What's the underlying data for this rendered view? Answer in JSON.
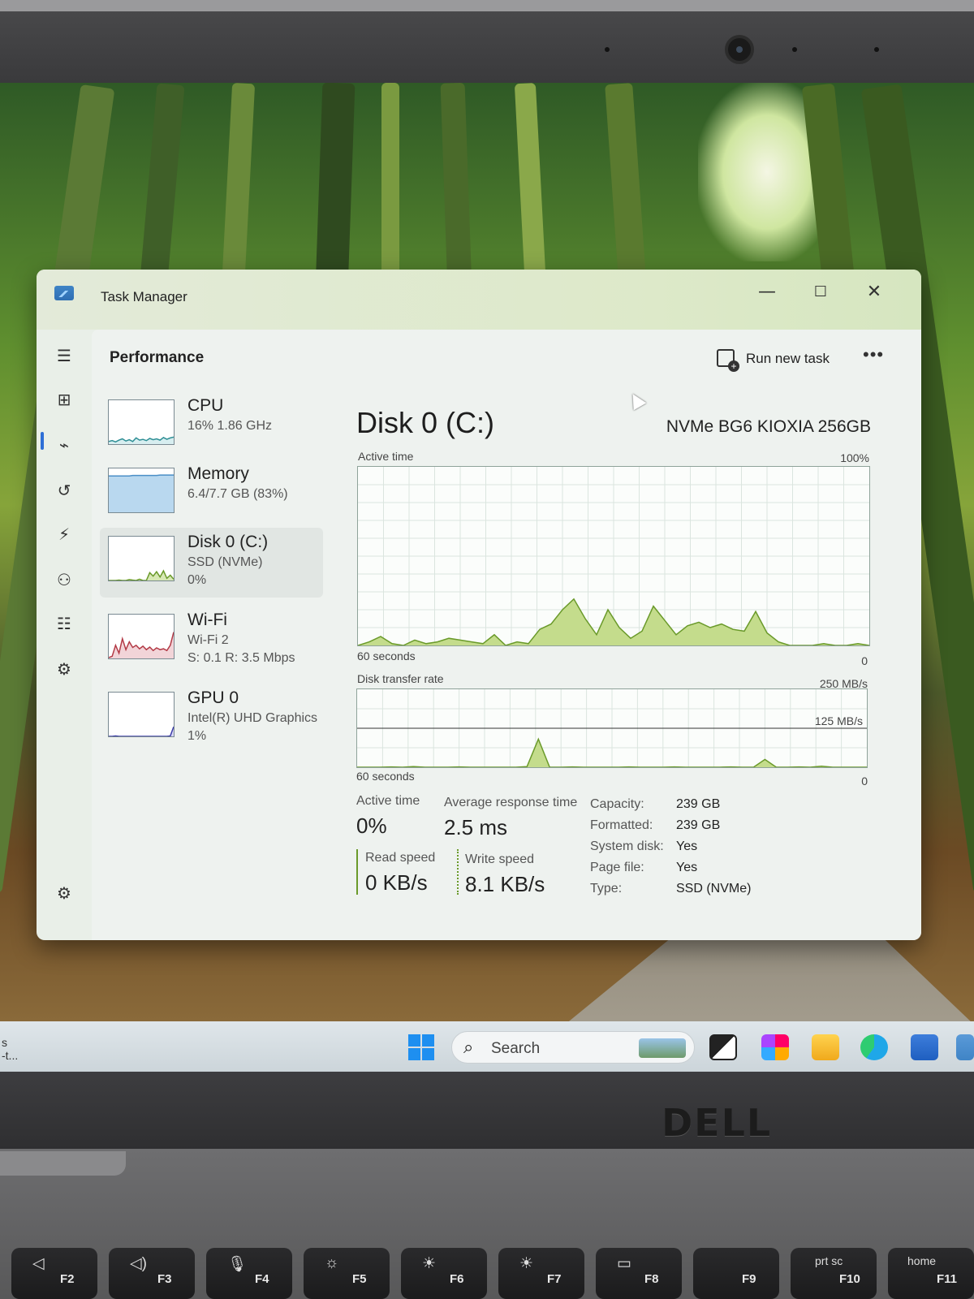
{
  "window": {
    "title": "Task Manager",
    "minimize_glyph": "—",
    "maximize_glyph": "☐",
    "close_glyph": "✕"
  },
  "page": {
    "title": "Performance",
    "run_new_task": "Run new task",
    "more_glyph": "•••"
  },
  "nav": {
    "icons": [
      "hamburger-icon",
      "processes-icon",
      "performance-icon",
      "app-history-icon",
      "startup-apps-icon",
      "users-icon",
      "details-icon",
      "services-icon",
      "settings-icon"
    ],
    "glyphs": [
      "☰",
      "⊞",
      "⌁",
      "↺",
      "⚡",
      "⚇",
      "☷",
      "⚙",
      "⚙"
    ]
  },
  "devices": [
    {
      "name": "CPU",
      "sub1": "16%  1.86 GHz",
      "sub2": "",
      "color": "#2f8f95",
      "selected": false
    },
    {
      "name": "Memory",
      "sub1": "6.4/7.7 GB (83%)",
      "sub2": "",
      "color": "#4b8fc7",
      "selected": false
    },
    {
      "name": "Disk 0 (C:)",
      "sub1": "SSD (NVMe)",
      "sub2": "0%",
      "color": "#6a9a2a",
      "selected": true
    },
    {
      "name": "Wi-Fi",
      "sub1": "Wi-Fi 2",
      "sub2": "S: 0.1  R: 3.5 Mbps",
      "color": "#b33a46",
      "selected": false
    },
    {
      "name": "GPU 0",
      "sub1": "Intel(R) UHD Graphics",
      "sub2": "1%",
      "color": "#3a3aa8",
      "selected": false
    }
  ],
  "detail": {
    "title": "Disk 0 (C:)",
    "model": "NVMe BG6 KIOXIA 256GB",
    "active_time_label": "Active time",
    "active_time_max": "100%",
    "active_time_span": "60 seconds",
    "active_time_min": "0",
    "transfer_label": "Disk transfer rate",
    "transfer_max": "250 MB/s",
    "transfer_mid": "125 MB/s",
    "transfer_span": "60 seconds",
    "transfer_min": "0"
  },
  "stats": {
    "active_time_label": "Active time",
    "active_time_value": "0%",
    "avg_response_label": "Average response time",
    "avg_response_value": "2.5 ms",
    "read_speed_label": "Read speed",
    "read_speed_value": "0 KB/s",
    "write_speed_label": "Write speed",
    "write_speed_value": "8.1 KB/s"
  },
  "properties": [
    {
      "key": "Capacity:",
      "value": "239 GB"
    },
    {
      "key": "Formatted:",
      "value": "239 GB"
    },
    {
      "key": "System disk:",
      "value": "Yes"
    },
    {
      "key": "Page file:",
      "value": "Yes"
    },
    {
      "key": "Type:",
      "value": "SSD (NVMe)"
    }
  ],
  "chart_data": [
    {
      "type": "area",
      "title": "Active time",
      "ylim": [
        0,
        100
      ],
      "x_span_seconds": 60,
      "values": [
        0,
        2,
        5,
        1,
        0,
        3,
        1,
        2,
        4,
        3,
        2,
        1,
        6,
        0,
        2,
        1,
        9,
        12,
        20,
        26,
        15,
        6,
        20,
        10,
        4,
        8,
        22,
        14,
        6,
        11,
        13,
        10,
        12,
        9,
        8,
        19,
        7,
        2,
        0,
        0,
        0,
        1,
        0,
        0,
        1,
        0
      ]
    },
    {
      "type": "area",
      "title": "Disk transfer rate",
      "ylim": [
        0,
        250
      ],
      "x_span_seconds": 60,
      "values": [
        0,
        0,
        0,
        1,
        0,
        2,
        0,
        0,
        0,
        1,
        0,
        0,
        0,
        0,
        0,
        2,
        90,
        0,
        0,
        1,
        0,
        0,
        0,
        0,
        1,
        0,
        0,
        0,
        1,
        0,
        0,
        0,
        0,
        1,
        0,
        0,
        25,
        0,
        0,
        1,
        0,
        3,
        0,
        0,
        0,
        0
      ]
    }
  ],
  "thumbs": {
    "cpu": [
      6,
      8,
      5,
      9,
      12,
      7,
      10,
      6,
      14,
      9,
      11,
      8,
      13,
      10,
      12,
      9,
      15,
      11,
      14,
      16
    ],
    "memory": [
      83,
      83,
      83,
      83,
      83,
      83,
      83,
      84,
      84,
      84,
      84,
      84,
      84,
      84,
      84,
      85,
      85,
      85,
      85,
      85
    ],
    "disk": [
      0,
      0,
      0,
      1,
      0,
      0,
      2,
      1,
      0,
      3,
      0,
      0,
      18,
      10,
      20,
      8,
      22,
      5,
      12,
      3
    ],
    "wifi": [
      2,
      5,
      30,
      12,
      45,
      20,
      38,
      25,
      30,
      22,
      28,
      20,
      26,
      18,
      24,
      20,
      22,
      18,
      30,
      60
    ],
    "gpu": [
      0,
      0,
      1,
      0,
      0,
      0,
      0,
      0,
      0,
      0,
      0,
      0,
      0,
      0,
      0,
      0,
      0,
      0,
      1,
      22
    ]
  },
  "taskbar": {
    "left_text_1": "s",
    "left_text_2": "-t...",
    "search_placeholder": "Search",
    "app_icons": [
      "task-view-icon",
      "copilot-icon",
      "file-explorer-icon",
      "edge-icon",
      "store-icon",
      "task-manager-icon"
    ]
  },
  "laptop": {
    "brand": "DELL",
    "keys": [
      {
        "sym": "◁",
        "fn": "F2"
      },
      {
        "sym": "◁)",
        "fn": "F3"
      },
      {
        "sym": "🎙",
        "fn": "F4"
      },
      {
        "sym": "☼",
        "fn": "F5"
      },
      {
        "sym": "☀",
        "fn": "F6"
      },
      {
        "sym": "☀",
        "fn": "F7"
      },
      {
        "sym": "▭",
        "fn": "F8"
      },
      {
        "sym": "",
        "fn": "F9"
      },
      {
        "sym": "prt sc",
        "fn": "F10"
      },
      {
        "sym": "home",
        "fn": "F11"
      }
    ]
  }
}
